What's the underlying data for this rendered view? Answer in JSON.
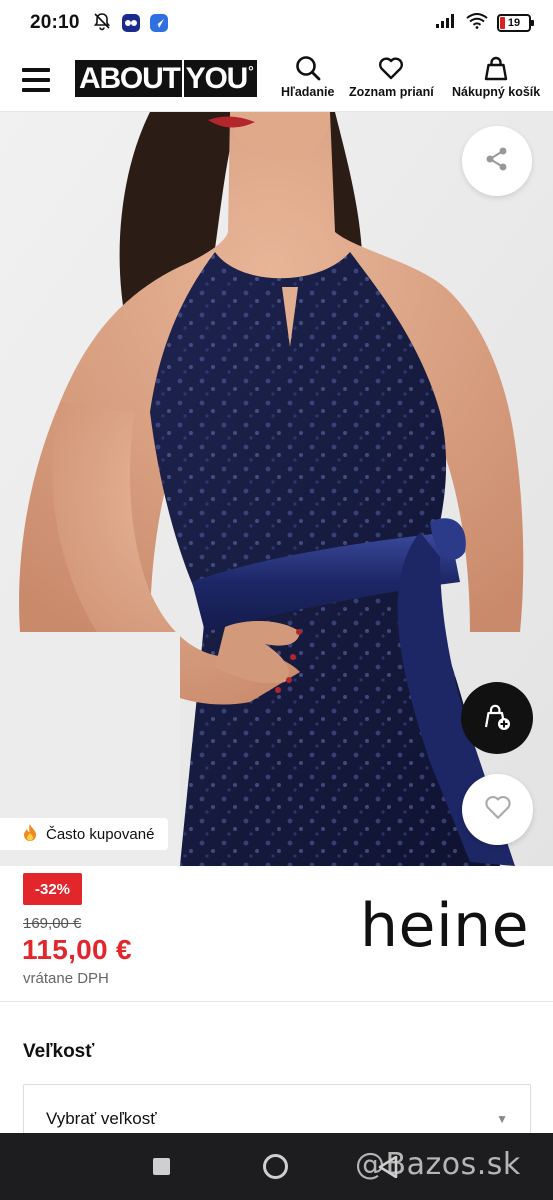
{
  "status_bar": {
    "time": "20:10",
    "battery": "19",
    "battery_color": "#e02020"
  },
  "header": {
    "logo_text_left": "ABOUT",
    "logo_text_right": "YOU",
    "search_label": "Hľadanie",
    "wishlist_label": "Zoznam prianí",
    "cart_label": "Nákupný košík",
    "icons": [
      "menu-icon",
      "search-icon",
      "heart-icon",
      "shopping-bag-icon"
    ]
  },
  "product": {
    "badge_text": "Často kupované",
    "badge_icon": "fire-icon",
    "discount": "-32%",
    "old_price": "169,00 €",
    "new_price": "115,00 €",
    "vat_note": "vrátane DPH",
    "brand": "heine",
    "accent_color": "#e2262c",
    "fab_icons": [
      "share-icon",
      "add-to-bag-icon",
      "heart-icon"
    ]
  },
  "size": {
    "title": "Veľkosť",
    "select_value": "Vybrať veľkosť"
  },
  "system_nav": {
    "icons": [
      "square-icon",
      "circle-icon",
      "back-triangle-icon"
    ],
    "watermark": "@Bazos.sk"
  }
}
